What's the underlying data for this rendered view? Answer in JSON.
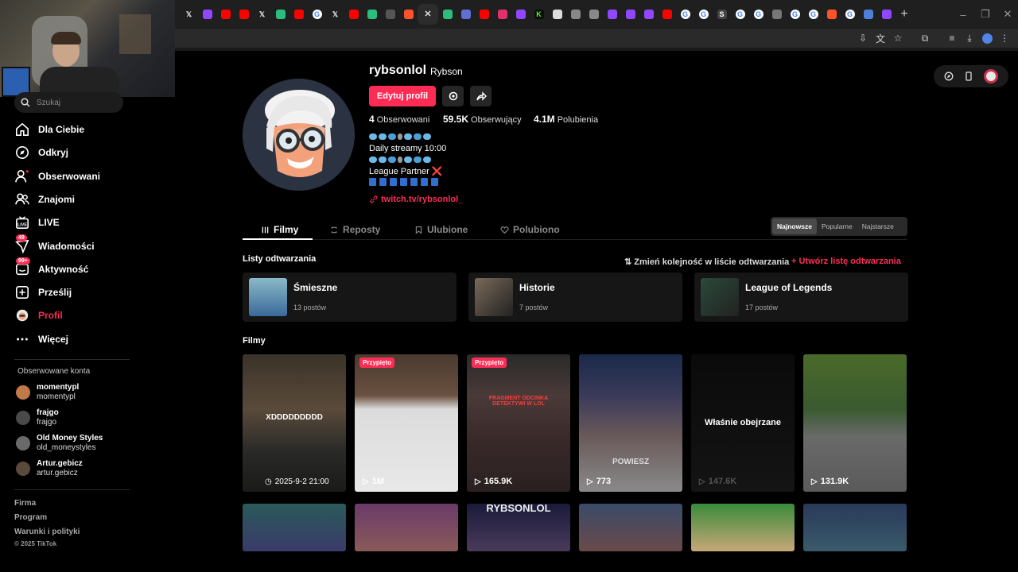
{
  "browser": {
    "tabs": [
      {
        "icon": "x-icon",
        "color": "#000000",
        "glyph": "𝕏"
      },
      {
        "icon": "twitch-icon",
        "color": "#9146ff",
        "glyph": ""
      },
      {
        "icon": "youtube-icon",
        "color": "#ff0000",
        "glyph": ""
      },
      {
        "icon": "youtube-icon",
        "color": "#ff0000",
        "glyph": ""
      },
      {
        "icon": "x-icon",
        "color": "#000000",
        "glyph": "𝕏"
      },
      {
        "icon": "sheets-icon",
        "color": "#2bbd7e",
        "glyph": ""
      },
      {
        "icon": "youtube-icon",
        "color": "#ff0000",
        "glyph": ""
      },
      {
        "icon": "google-icon",
        "color": "#4285f4",
        "glyph": "G"
      },
      {
        "icon": "x-icon",
        "color": "#000000",
        "glyph": "𝕏"
      },
      {
        "icon": "youtube-icon",
        "color": "#ff0000",
        "glyph": ""
      },
      {
        "icon": "sheets-icon",
        "color": "#2bbd7e",
        "glyph": ""
      },
      {
        "icon": "bank-icon",
        "color": "#555555",
        "glyph": ""
      },
      {
        "icon": "brave-icon",
        "color": "#fb542b",
        "glyph": ""
      },
      {
        "icon": "close-icon",
        "color": "#2c2c2c",
        "glyph": "✕",
        "active": true
      },
      {
        "icon": "sheets-icon",
        "color": "#2bbd7e",
        "glyph": ""
      },
      {
        "icon": "window-icon",
        "color": "#5f6fd6",
        "glyph": ""
      },
      {
        "icon": "youtube-icon",
        "color": "#ff0000",
        "glyph": ""
      },
      {
        "icon": "instagram-icon",
        "color": "#e1306c",
        "glyph": ""
      },
      {
        "icon": "twitch-icon",
        "color": "#9146ff",
        "glyph": ""
      },
      {
        "icon": "kick-icon",
        "color": "#53fc18",
        "glyph": "K"
      },
      {
        "icon": "diamond-icon",
        "color": "#dddddd",
        "glyph": ""
      },
      {
        "icon": "globe-icon",
        "color": "#888888",
        "glyph": ""
      },
      {
        "icon": "globe-icon",
        "color": "#888888",
        "glyph": ""
      },
      {
        "icon": "twitch-icon",
        "color": "#9146ff",
        "glyph": ""
      },
      {
        "icon": "twitch-icon",
        "color": "#9146ff",
        "glyph": ""
      },
      {
        "icon": "twitch-icon",
        "color": "#9146ff",
        "glyph": ""
      },
      {
        "icon": "youtube-icon",
        "color": "#ff0000",
        "glyph": ""
      },
      {
        "icon": "google-icon",
        "color": "#4285f4",
        "glyph": "G"
      },
      {
        "icon": "google-icon",
        "color": "#4285f4",
        "glyph": "G"
      },
      {
        "icon": "link-icon",
        "color": "#444444",
        "glyph": "S"
      },
      {
        "icon": "google-icon",
        "color": "#4285f4",
        "glyph": "G"
      },
      {
        "icon": "google-icon",
        "color": "#4285f4",
        "glyph": "G"
      },
      {
        "icon": "openai-icon",
        "color": "#777777",
        "glyph": ""
      },
      {
        "icon": "google-icon",
        "color": "#4285f4",
        "glyph": "G"
      },
      {
        "icon": "google-icon",
        "color": "#4285f4",
        "glyph": "G"
      },
      {
        "icon": "brave-icon",
        "color": "#fb542b",
        "glyph": ""
      },
      {
        "icon": "google-icon",
        "color": "#4285f4",
        "glyph": "G"
      },
      {
        "icon": "shield-icon",
        "color": "#4f7fd8",
        "glyph": ""
      },
      {
        "icon": "twitch-icon",
        "color": "#9146ff",
        "glyph": ""
      }
    ],
    "new_tab": "+",
    "minimize": "–",
    "restore": "❐",
    "close": "✕"
  },
  "sidebar": {
    "search_placeholder": "Szukaj",
    "items": [
      {
        "name": "dla-ciebie",
        "label": "Dla Ciebie",
        "icon": "home-icon"
      },
      {
        "name": "odkryj",
        "label": "Odkryj",
        "icon": "compass-icon"
      },
      {
        "name": "obserwowani",
        "label": "Obserwowani",
        "icon": "user-follow-icon"
      },
      {
        "name": "znajomi",
        "label": "Znajomi",
        "icon": "friends-icon"
      },
      {
        "name": "live",
        "label": "LIVE",
        "icon": "live-icon"
      },
      {
        "name": "wiadomosci",
        "label": "Wiadomości",
        "icon": "message-icon",
        "badge": "49"
      },
      {
        "name": "aktywnosc",
        "label": "Aktywność",
        "icon": "inbox-icon",
        "badge": "99+"
      },
      {
        "name": "przeslij",
        "label": "Prześlij",
        "icon": "upload-icon"
      },
      {
        "name": "profil",
        "label": "Profil",
        "icon": "profile-avatar-icon",
        "active": true
      },
      {
        "name": "wiecej",
        "label": "Więcej",
        "icon": "more-icon"
      }
    ],
    "following_title": "Obserwowane konta",
    "following": [
      {
        "name": "momentypl",
        "handle": "momentypl",
        "color": "#c07a4a"
      },
      {
        "name": "frajgo",
        "handle": "frajgo",
        "color": "#4a4a4a"
      },
      {
        "name": "Old Money Styles",
        "handle": "old_moneystyles",
        "color": "#6a6a6a"
      },
      {
        "name": "Artur.gebicz",
        "handle": "artur.gebicz",
        "color": "#5a4a3a"
      }
    ],
    "footer": [
      "Firma",
      "Program",
      "Warunki i polityki",
      "© 2025 TikTok"
    ]
  },
  "profile": {
    "username": "rybsonlol",
    "display_name": "Rybson",
    "edit_label": "Edytuj profil",
    "stats": [
      {
        "value": "4",
        "label": "Obserwowani"
      },
      {
        "value": "59.5K",
        "label": "Obserwujący"
      },
      {
        "value": "4.1M",
        "label": "Polubienia"
      }
    ],
    "bio_lines": [
      "Daily streamy 10:00",
      "League Partner ❌"
    ],
    "link": "twitch.tv/rybsonlol_"
  },
  "tabs": [
    {
      "label": "Filmy",
      "icon": "grid-icon",
      "active": true
    },
    {
      "label": "Reposty",
      "icon": "repost-icon"
    },
    {
      "label": "Ulubione",
      "icon": "bookmark-icon"
    },
    {
      "label": "Polubiono",
      "icon": "heart-icon"
    }
  ],
  "sort": [
    "Najnowsze",
    "Popularne",
    "Najstarsze"
  ],
  "playlists": {
    "title": "Listy odtwarzania",
    "reorder": "Zmień kolejność w liście odtwarzania",
    "create": "Utwórz listę odtwarzania",
    "items": [
      {
        "name": "Śmieszne",
        "count": "13 postów",
        "color": "#3a6a9a"
      },
      {
        "name": "Historie",
        "count": "7 postów",
        "color": "#7a6a5a"
      },
      {
        "name": "League of Legends",
        "count": "17 postów",
        "color": "#2a4a3a"
      }
    ]
  },
  "films_title": "Filmy",
  "videos": [
    {
      "caption": "2025-9-2 21:00",
      "icon": "clock-icon",
      "overlay": "XDDDDDDDDD",
      "pinned": false,
      "bg": "linear-gradient(180deg,#3a3328 0%,#5a4a3a 40%,#2a2a28 70%,#1a1a18 100%)"
    },
    {
      "caption": "1M",
      "icon": "play-icon",
      "overlay": "",
      "pinned": true,
      "bg": "linear-gradient(180deg,#4a3a30 0%,#6a5040 30%,#dcdcdc 40%,#e8e8e8 100%)"
    },
    {
      "caption": "165.9K",
      "icon": "play-icon",
      "overlay": "FRAGMENT ODCINKA DETEKTYWI W LOL",
      "pinned": true,
      "bg": "linear-gradient(180deg,#2a2a2a 0%,#4a3a38 30%,#3a2a2a 60%,#2a2020 100%)"
    },
    {
      "caption": "773",
      "icon": "play-icon",
      "overlay": "POWIESZ",
      "pinned": false,
      "bg": "linear-gradient(180deg,#1a2a4a 0%,#3a3a5a 30%,#6a5a5a 60%,#8a8a8a 100%)"
    },
    {
      "caption": "147.6K",
      "icon": "play-icon",
      "overlay": "Właśnie obejrzane",
      "pinned": false,
      "bg": "linear-gradient(180deg,#0a0a0a 0%,#141414 100%)"
    },
    {
      "caption": "131.9K",
      "icon": "play-icon",
      "overlay": "",
      "pinned": false,
      "bg": "linear-gradient(180deg,#4a6a2a 0%,#3a5a30 40%,#6a6a6a 60%,#5a5a5a 100%)"
    }
  ],
  "videos_row2": [
    {
      "bg": "linear-gradient(180deg,#2a5a5a,#3a3a6a)"
    },
    {
      "bg": "linear-gradient(180deg,#6a3a6a,#8a5a5a)"
    },
    {
      "bg": "linear-gradient(180deg,#1a1a3a,#4a3a5a)",
      "overlay": "RYBSONLOL"
    },
    {
      "bg": "linear-gradient(180deg,#3a4a6a,#6a4a4a)"
    },
    {
      "bg": "linear-gradient(180deg,#3a8a3a,#c8a878)"
    },
    {
      "bg": "linear-gradient(180deg,#2a3a5a,#3a5a6a)"
    }
  ]
}
